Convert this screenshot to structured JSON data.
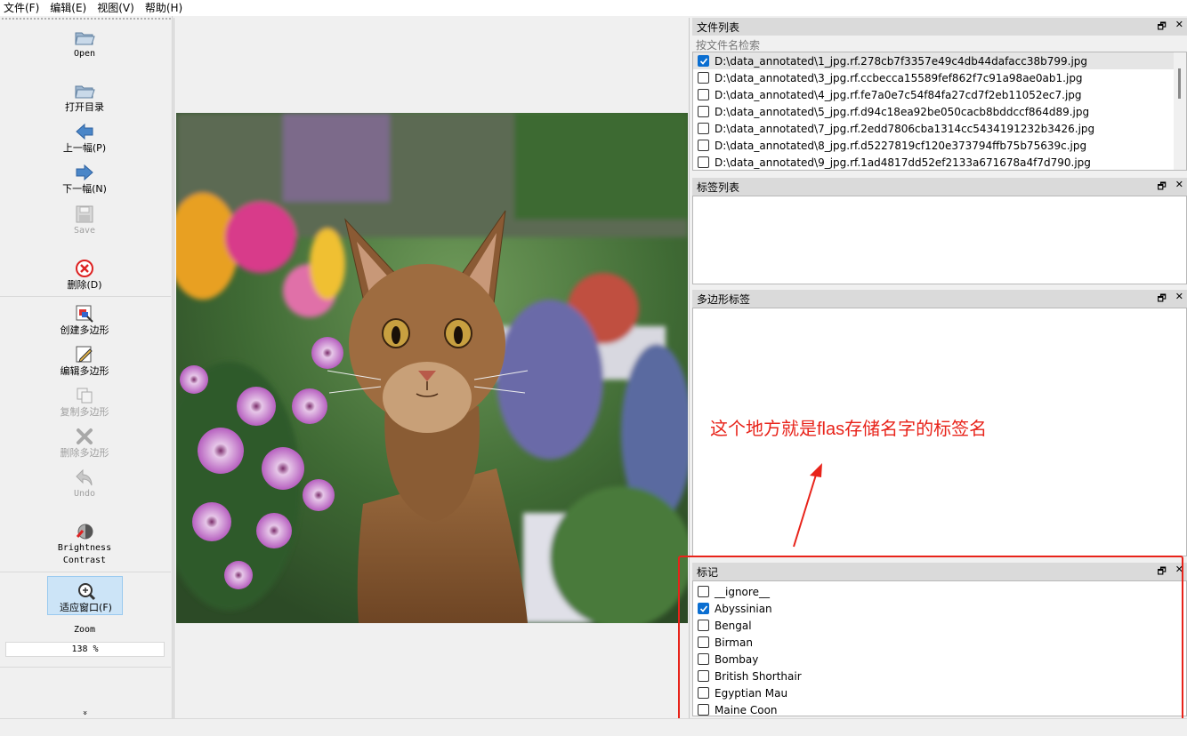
{
  "menu": [
    "文件(F)",
    "编辑(E)",
    "视图(V)",
    "帮助(H)"
  ],
  "toolbar": {
    "open": "Open",
    "open_dir": "打开目录",
    "prev": "上一幅(P)",
    "next": "下一幅(N)",
    "save": "Save",
    "delete": "删除(D)",
    "create_polygon": "创建多边形",
    "edit_polygon": "编辑多边形",
    "copy_polygon": "复制多边形",
    "delete_polygon": "删除多边形",
    "undo": "Undo",
    "brightness": "Brightness",
    "contrast": "Contrast",
    "fit_window": "适应窗口(F)",
    "zoom_label": "Zoom",
    "zoom_value": "138 %",
    "more": "»"
  },
  "file_dock": {
    "title": "文件列表",
    "search_placeholder": "按文件名检索",
    "files": [
      {
        "name": "D:\\data_annotated\\1_jpg.rf.278cb7f3357e49c4db44dafacc38b799.jpg",
        "checked": true
      },
      {
        "name": "D:\\data_annotated\\3_jpg.rf.ccbecca15589fef862f7c91a98ae0ab1.jpg",
        "checked": false
      },
      {
        "name": "D:\\data_annotated\\4_jpg.rf.fe7a0e7c54f84fa27cd7f2eb11052ec7.jpg",
        "checked": false
      },
      {
        "name": "D:\\data_annotated\\5_jpg.rf.d94c18ea92be050cacb8bddccf864d89.jpg",
        "checked": false
      },
      {
        "name": "D:\\data_annotated\\7_jpg.rf.2edd7806cba1314cc5434191232b3426.jpg",
        "checked": false
      },
      {
        "name": "D:\\data_annotated\\8_jpg.rf.d5227819cf120e373794ffb75b75639c.jpg",
        "checked": false
      },
      {
        "name": "D:\\data_annotated\\9_jpg.rf.1ad4817dd52ef2133a671678a4f7d790.jpg",
        "checked": false
      }
    ]
  },
  "label_dock": {
    "title": "标签列表"
  },
  "polygon_dock": {
    "title": "多边形标签"
  },
  "flag_dock": {
    "title": "标记",
    "flags": [
      {
        "name": "__ignore__",
        "checked": false
      },
      {
        "name": "Abyssinian",
        "checked": true
      },
      {
        "name": "Bengal",
        "checked": false
      },
      {
        "name": "Birman",
        "checked": false
      },
      {
        "name": "Bombay",
        "checked": false
      },
      {
        "name": "British Shorthair",
        "checked": false
      },
      {
        "name": "Egyptian Mau",
        "checked": false
      },
      {
        "name": "Maine Coon",
        "checked": false
      }
    ]
  },
  "dock_buttons": {
    "float": "🗗",
    "close": "✕"
  },
  "annotation": {
    "text": "这个地方就是flas存储名字的标签名",
    "color": "#e8231a"
  }
}
